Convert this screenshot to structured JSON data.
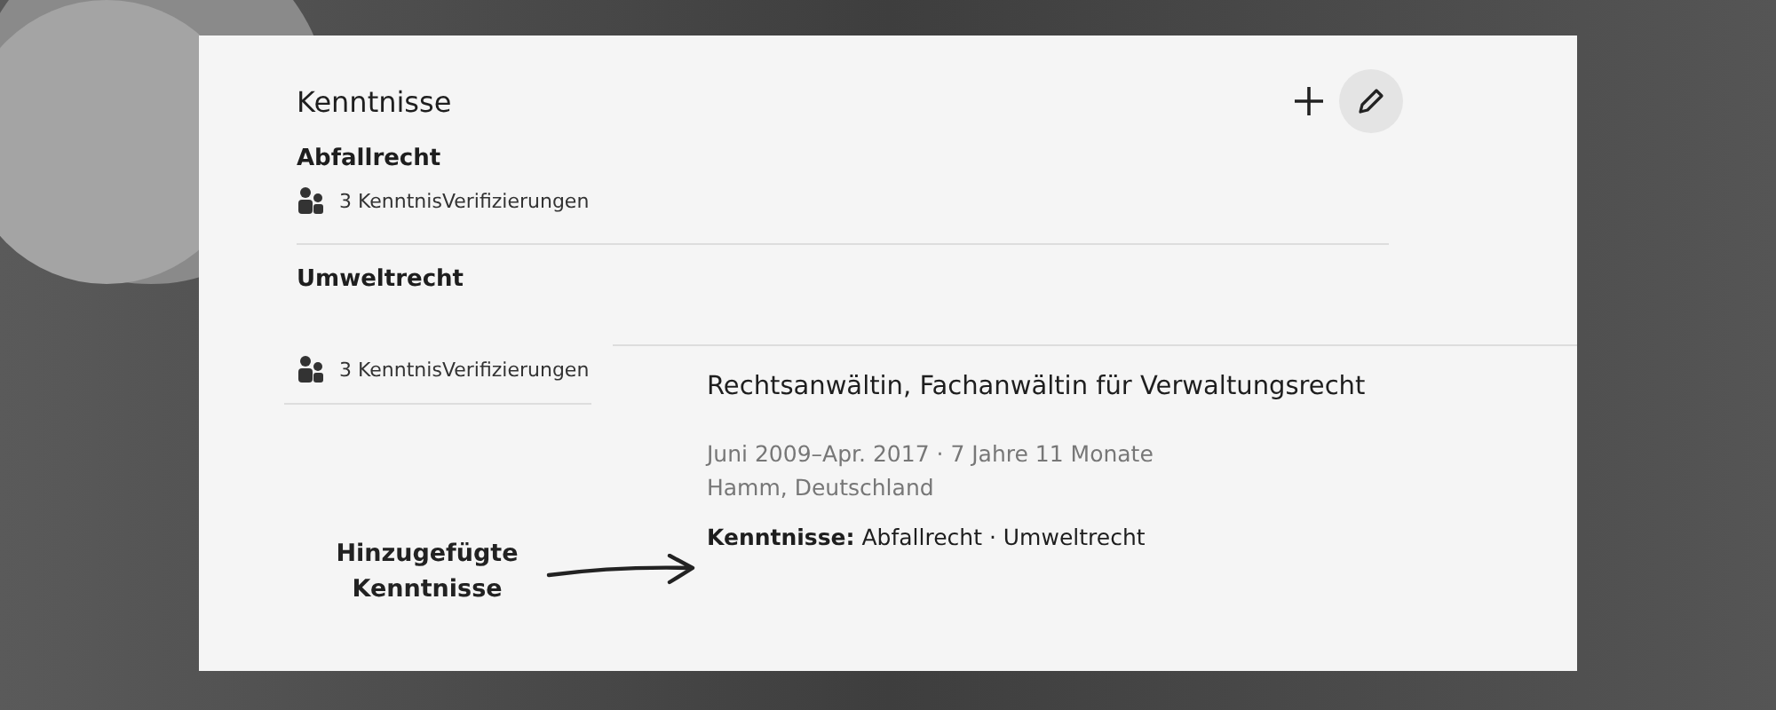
{
  "skills": {
    "title": "Kenntnisse",
    "items": [
      {
        "name": "Abfallrecht",
        "verifications": "3 KenntnisVerifizierungen"
      },
      {
        "name": "Umweltrecht",
        "verifications": "3 KenntnisVerifizierungen"
      }
    ]
  },
  "experience": {
    "title": "Rechtsanwältin, Fachanwältin für Verwaltungsrecht",
    "dates": "Juni 2009–Apr. 2017 · 7 Jahre 11 Monate",
    "location": "Hamm, Deutschland",
    "skills": "**Kenntnisse:** Abfallrecht · Umweltrecht"
  },
  "annotation": {
    "text": "Hinzugefügte Kenntnisse"
  }
}
